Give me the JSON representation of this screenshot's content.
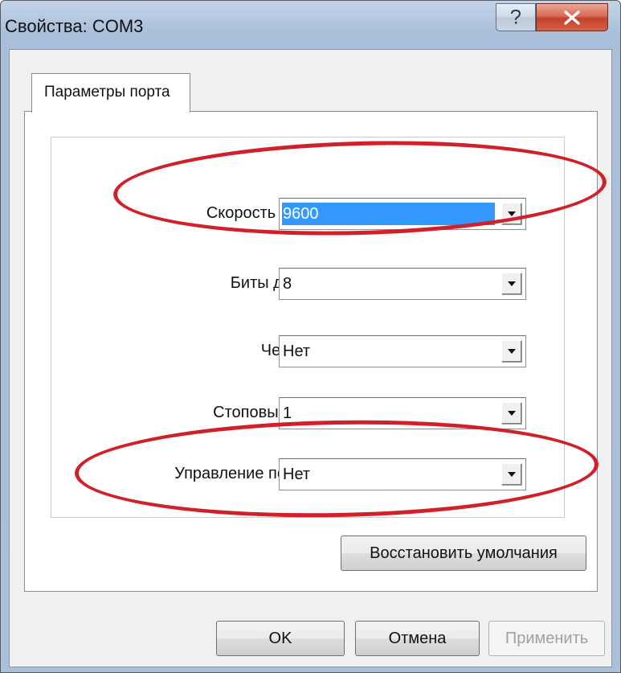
{
  "window": {
    "title": "Свойства: COM3",
    "help_icon": "question-mark-icon",
    "close_icon": "close-x-icon"
  },
  "tabs": [
    {
      "label": "Параметры порта",
      "active": true
    }
  ],
  "fields": {
    "speed": {
      "label": "Скорость (бит/с):",
      "value": "9600"
    },
    "data_bits": {
      "label": "Биты данных:",
      "value": "8"
    },
    "parity": {
      "label": "Четность:",
      "value": "Нет"
    },
    "stop_bits": {
      "label": "Стоповые биты:",
      "value": "1"
    },
    "flow_control": {
      "label": "Управление потоком:",
      "value": "Нет"
    }
  },
  "buttons": {
    "restore_defaults": "Восстановить умолчания",
    "ok": "OK",
    "cancel": "Отмена",
    "apply": "Применить"
  },
  "highlight_color": "#d0202a",
  "selection_color": "#3399ff"
}
